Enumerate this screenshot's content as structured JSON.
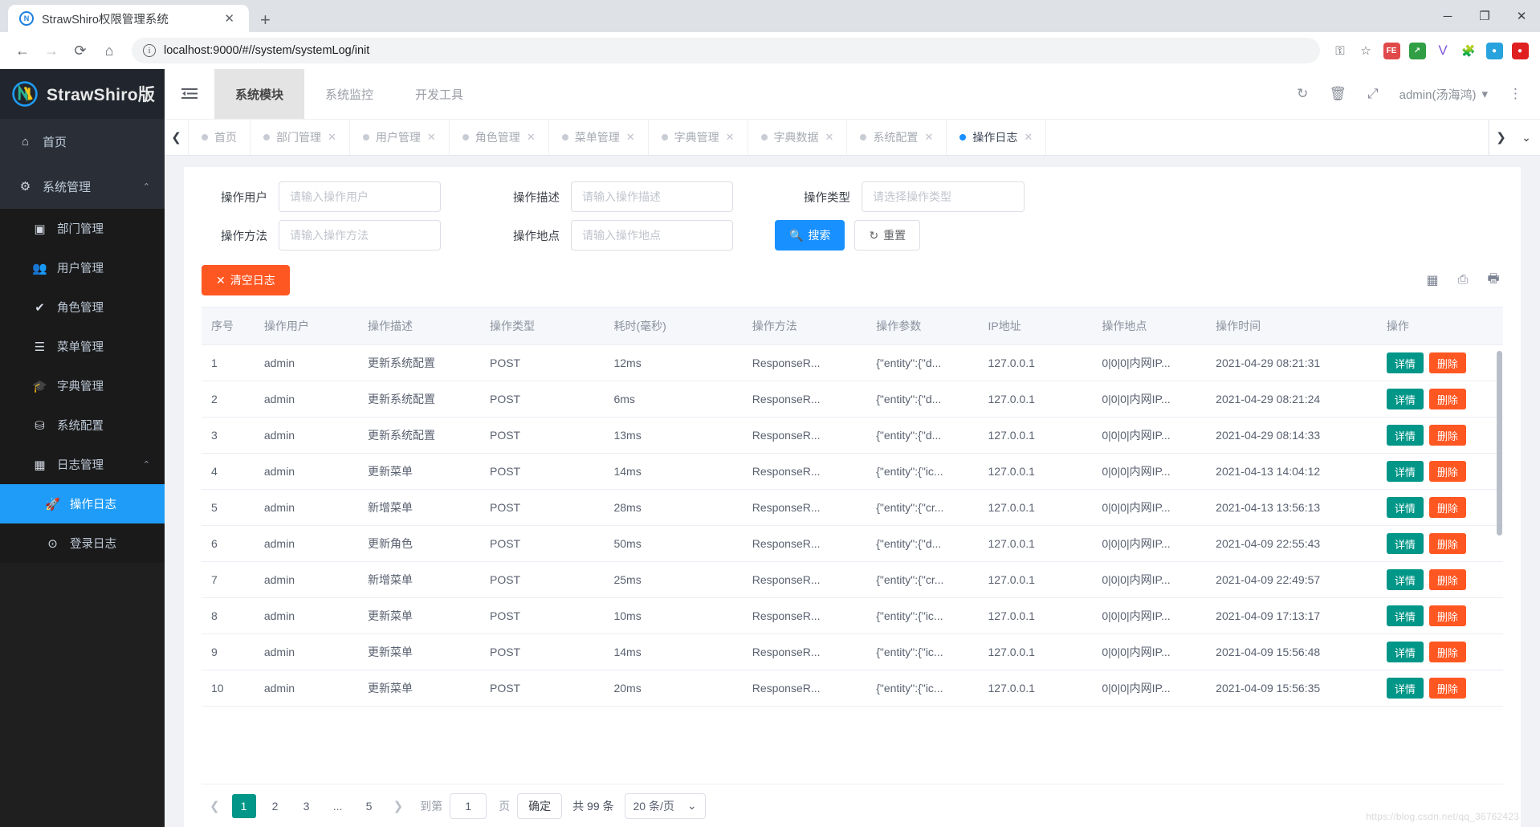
{
  "browser": {
    "tab_title": "StrawShiro权限管理系统",
    "favicon_letter": "N",
    "tab_close": "✕",
    "new_tab": "+",
    "url": "localhost:9000/#//system/systemLog/init",
    "back_icon": "←",
    "forward_icon": "→",
    "reload_icon": "⟳",
    "home_icon": "⌂",
    "info_icon": "ⓘ",
    "key_icon": "⚿",
    "star_icon": "☆",
    "window_minimize": "─",
    "window_maximize": "❐",
    "window_close": "✕",
    "extensions": [
      {
        "name": "extension-fe",
        "label": "FE",
        "color": "#e04a4a"
      },
      {
        "name": "extension-green",
        "label": "↗",
        "color": "#34a853"
      },
      {
        "name": "extension-v",
        "label": "V",
        "color": "#7f56d9"
      },
      {
        "name": "extension-puzzle",
        "label": "🧩",
        "color": "#5f6368"
      },
      {
        "name": "extension-profile",
        "label": "●",
        "color": "#1f9cf7"
      },
      {
        "name": "extension-red",
        "label": "●",
        "color": "#e02020"
      }
    ]
  },
  "sidebar": {
    "brand": "StrawShiro版",
    "home": {
      "label": "首页",
      "icon": "home-icon"
    },
    "system_mgmt": {
      "label": "系统管理",
      "icon": "gears-icon",
      "caret": "⌃"
    },
    "items": [
      {
        "label": "部门管理",
        "icon": "id-badge-icon"
      },
      {
        "label": "用户管理",
        "icon": "users-icon"
      },
      {
        "label": "角色管理",
        "icon": "check-icon"
      },
      {
        "label": "菜单管理",
        "icon": "list-icon"
      },
      {
        "label": "字典管理",
        "icon": "graduation-cap-icon"
      },
      {
        "label": "系统配置",
        "icon": "cubes-icon"
      }
    ],
    "log_mgmt": {
      "label": "日志管理",
      "icon": "calendar-icon",
      "caret": "⌃"
    },
    "log_items": [
      {
        "label": "操作日志",
        "icon": "rocket-icon",
        "active": true
      },
      {
        "label": "登录日志",
        "icon": "arrow-circle-icon",
        "active": false
      }
    ]
  },
  "topbar": {
    "collapse_icon": "collapse-menu-icon",
    "nav": [
      {
        "label": "系统模块",
        "active": true
      },
      {
        "label": "系统监控",
        "active": false
      },
      {
        "label": "开发工具",
        "active": false
      }
    ],
    "refresh_icon": "↻",
    "trash_icon": "🗑",
    "fullscreen_icon": "⤢",
    "user": "admin(汤海鸿)",
    "user_caret": "▾",
    "more_icon": "⋮"
  },
  "page_tabs": {
    "prev_arrow": "❮",
    "next_arrow": "❯",
    "dropdown_arrow": "⌄",
    "close_mark": "✕",
    "items": [
      {
        "label": "首页",
        "active": false,
        "closable": false
      },
      {
        "label": "部门管理",
        "active": false,
        "closable": true
      },
      {
        "label": "用户管理",
        "active": false,
        "closable": true
      },
      {
        "label": "角色管理",
        "active": false,
        "closable": true
      },
      {
        "label": "菜单管理",
        "active": false,
        "closable": true
      },
      {
        "label": "字典管理",
        "active": false,
        "closable": true
      },
      {
        "label": "字典数据",
        "active": false,
        "closable": true
      },
      {
        "label": "系统配置",
        "active": false,
        "closable": true
      },
      {
        "label": "操作日志",
        "active": true,
        "closable": true
      }
    ]
  },
  "search_form": {
    "user_label": "操作用户",
    "user_placeholder": "请输入操作用户",
    "desc_label": "操作描述",
    "desc_placeholder": "请输入操作描述",
    "type_label": "操作类型",
    "type_placeholder": "请选择操作类型",
    "method_label": "操作方法",
    "method_placeholder": "请输入操作方法",
    "place_label": "操作地点",
    "place_placeholder": "请输入操作地点",
    "search_button": "搜索",
    "search_icon": "🔍",
    "reset_button": "重置",
    "reset_icon": "↻"
  },
  "toolbar": {
    "clear_logs": "清空日志",
    "clear_icon": "✕",
    "icons": [
      {
        "name": "columns-icon",
        "glyph": "▦"
      },
      {
        "name": "export-icon",
        "glyph": "⎙"
      },
      {
        "name": "print-icon",
        "glyph": "🖶"
      }
    ]
  },
  "table": {
    "columns": [
      "序号",
      "操作用户",
      "操作描述",
      "操作类型",
      "耗时(毫秒)",
      "操作方法",
      "操作参数",
      "IP地址",
      "操作地点",
      "操作时间",
      "操作"
    ],
    "detail_label": "详情",
    "delete_label": "删除",
    "rows": [
      {
        "no": "1",
        "user": "admin",
        "desc": "更新系统配置",
        "type": "POST",
        "cost": "12ms",
        "method": "ResponseR...",
        "params": "{\"entity\":{\"d...",
        "ip": "127.0.0.1",
        "place": "0|0|0|内网IP...",
        "time": "2021-04-29 08:21:31"
      },
      {
        "no": "2",
        "user": "admin",
        "desc": "更新系统配置",
        "type": "POST",
        "cost": "6ms",
        "method": "ResponseR...",
        "params": "{\"entity\":{\"d...",
        "ip": "127.0.0.1",
        "place": "0|0|0|内网IP...",
        "time": "2021-04-29 08:21:24"
      },
      {
        "no": "3",
        "user": "admin",
        "desc": "更新系统配置",
        "type": "POST",
        "cost": "13ms",
        "method": "ResponseR...",
        "params": "{\"entity\":{\"d...",
        "ip": "127.0.0.1",
        "place": "0|0|0|内网IP...",
        "time": "2021-04-29 08:14:33"
      },
      {
        "no": "4",
        "user": "admin",
        "desc": "更新菜单",
        "type": "POST",
        "cost": "14ms",
        "method": "ResponseR...",
        "params": "{\"entity\":{\"ic...",
        "ip": "127.0.0.1",
        "place": "0|0|0|内网IP...",
        "time": "2021-04-13 14:04:12"
      },
      {
        "no": "5",
        "user": "admin",
        "desc": "新增菜单",
        "type": "POST",
        "cost": "28ms",
        "method": "ResponseR...",
        "params": "{\"entity\":{\"cr...",
        "ip": "127.0.0.1",
        "place": "0|0|0|内网IP...",
        "time": "2021-04-13 13:56:13"
      },
      {
        "no": "6",
        "user": "admin",
        "desc": "更新角色",
        "type": "POST",
        "cost": "50ms",
        "method": "ResponseR...",
        "params": "{\"entity\":{\"d...",
        "ip": "127.0.0.1",
        "place": "0|0|0|内网IP...",
        "time": "2021-04-09 22:55:43"
      },
      {
        "no": "7",
        "user": "admin",
        "desc": "新增菜单",
        "type": "POST",
        "cost": "25ms",
        "method": "ResponseR...",
        "params": "{\"entity\":{\"cr...",
        "ip": "127.0.0.1",
        "place": "0|0|0|内网IP...",
        "time": "2021-04-09 22:49:57"
      },
      {
        "no": "8",
        "user": "admin",
        "desc": "更新菜单",
        "type": "POST",
        "cost": "10ms",
        "method": "ResponseR...",
        "params": "{\"entity\":{\"ic...",
        "ip": "127.0.0.1",
        "place": "0|0|0|内网IP...",
        "time": "2021-04-09 17:13:17"
      },
      {
        "no": "9",
        "user": "admin",
        "desc": "更新菜单",
        "type": "POST",
        "cost": "14ms",
        "method": "ResponseR...",
        "params": "{\"entity\":{\"ic...",
        "ip": "127.0.0.1",
        "place": "0|0|0|内网IP...",
        "time": "2021-04-09 15:56:48"
      },
      {
        "no": "10",
        "user": "admin",
        "desc": "更新菜单",
        "type": "POST",
        "cost": "20ms",
        "method": "ResponseR...",
        "params": "{\"entity\":{\"ic...",
        "ip": "127.0.0.1",
        "place": "0|0|0|内网IP...",
        "time": "2021-04-09 15:56:35"
      }
    ]
  },
  "pagination": {
    "prev": "❮",
    "next": "❯",
    "pages": [
      "1",
      "2",
      "3",
      "...",
      "5"
    ],
    "current": "1",
    "goto_label": "到第",
    "goto_value": "1",
    "page_unit": "页",
    "confirm": "确定",
    "total": "共 99 条",
    "page_size": "20 条/页",
    "size_caret": "⌄"
  },
  "watermark": "https://blog.csdn.net/qq_36762423"
}
